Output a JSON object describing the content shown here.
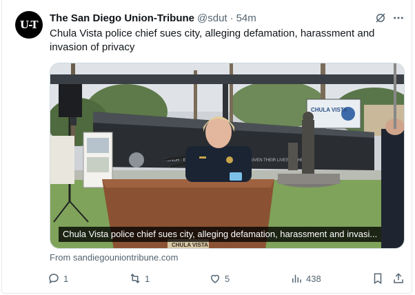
{
  "tweet": {
    "avatar_text": "U-T",
    "display_name": "The San Diego Union-Tribune",
    "handle": "@sdut",
    "separator": "·",
    "time": "54m",
    "text": "Chula Vista police chief sues city, alleging defamation, harassment and invasion of privacy",
    "media": {
      "caption": "Chula Vista police chief sues city, alleging defamation, harassment and invasi...",
      "sign_text": "CHULA VISTA",
      "memorial_text": "HONOR · ENFORCEMENT OFFICERS WHO GIVEN THEIR LIVES IN THE",
      "podium_label": "CHULA VISTA"
    },
    "source": "From sandiegouniontribune.com",
    "icons": {
      "grok": "grok-icon",
      "more": "more-icon",
      "reply": "reply-icon",
      "retweet": "retweet-icon",
      "like": "heart-icon",
      "views": "views-icon",
      "bookmark": "bookmark-icon",
      "share": "share-icon"
    },
    "actions": {
      "replies": "1",
      "retweets": "1",
      "likes": "5",
      "views": "438"
    }
  }
}
